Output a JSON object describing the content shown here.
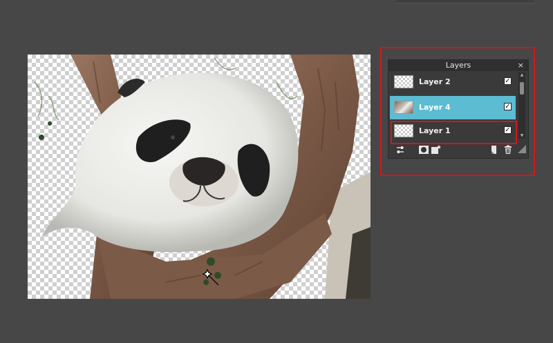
{
  "layers_panel": {
    "title": "Layers",
    "close_label": "×",
    "layers": [
      {
        "name": "Layer 2",
        "visible": true,
        "active": false
      },
      {
        "name": "Layer 4",
        "visible": true,
        "active": true
      },
      {
        "name": "Layer 1",
        "visible": true,
        "active": false
      }
    ],
    "check_glyph": "✓",
    "toolbar_icons": [
      "adjust-icon",
      "mask-circle-icon",
      "effects-icon",
      "new-layer-icon",
      "trash-icon",
      "resize-grip-icon"
    ]
  },
  "colors": {
    "background": "#474747",
    "active_layer": "#5cbcd2",
    "highlight": "#d4161c"
  }
}
